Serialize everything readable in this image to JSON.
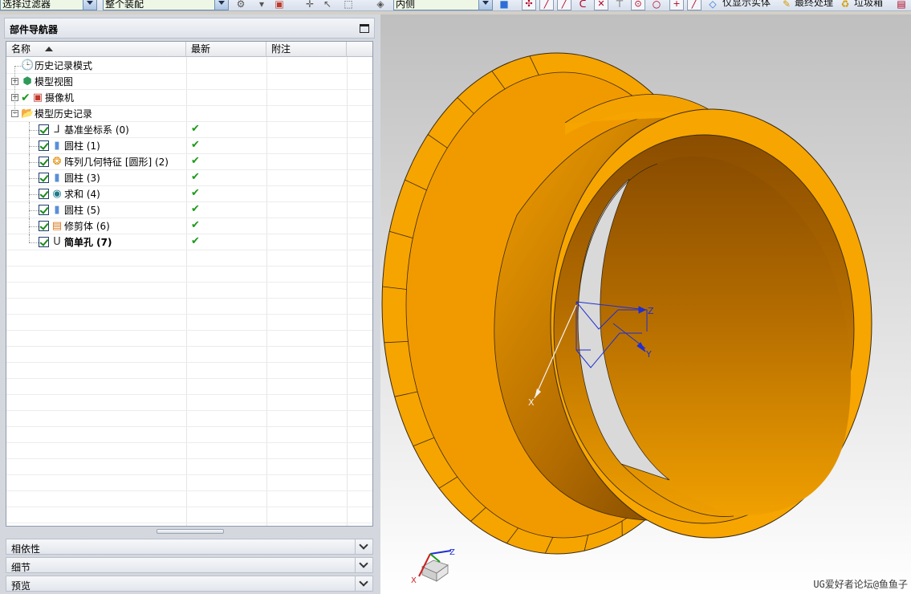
{
  "toolbar": {
    "filter_value": "选择过滤器",
    "scope_value": "整个装配",
    "side_value": "内侧",
    "show_solid_label": "仅显示实体",
    "final_process_label": "最终处理",
    "trash_label": "垃圾箱"
  },
  "navigator": {
    "title": "部件导航器",
    "columns": [
      "名称",
      "最新",
      "附注"
    ],
    "items": [
      {
        "label": "历史记录模式",
        "level": 0,
        "expander": "",
        "checkbox": false,
        "icon": "clock-icon",
        "latest": false,
        "bold": false
      },
      {
        "label": "模型视图",
        "level": 0,
        "expander": "+",
        "checkbox": false,
        "icon": "cube-view-icon",
        "latest": false,
        "bold": false
      },
      {
        "label": "摄像机",
        "level": 0,
        "expander": "+",
        "checkbox": false,
        "icon": "camera-icon",
        "latest": false,
        "bold": false
      },
      {
        "label": "模型历史记录",
        "level": 0,
        "expander": "-",
        "checkbox": false,
        "icon": "folder-icon",
        "latest": false,
        "bold": false
      },
      {
        "label": "基准坐标系 (0)",
        "level": 1,
        "expander": "",
        "checkbox": true,
        "icon": "datum-csys-icon",
        "latest": true,
        "bold": false
      },
      {
        "label": "圆柱 (1)",
        "level": 1,
        "expander": "",
        "checkbox": true,
        "icon": "cylinder-icon",
        "latest": true,
        "bold": false
      },
      {
        "label": "阵列几何特征 [圆形] (2)",
        "level": 1,
        "expander": "",
        "checkbox": true,
        "icon": "pattern-icon",
        "latest": true,
        "bold": false
      },
      {
        "label": "圆柱 (3)",
        "level": 1,
        "expander": "",
        "checkbox": true,
        "icon": "cylinder-icon",
        "latest": true,
        "bold": false
      },
      {
        "label": "求和 (4)",
        "level": 1,
        "expander": "",
        "checkbox": true,
        "icon": "unite-icon",
        "latest": true,
        "bold": false
      },
      {
        "label": "圆柱 (5)",
        "level": 1,
        "expander": "",
        "checkbox": true,
        "icon": "cylinder-icon",
        "latest": true,
        "bold": false
      },
      {
        "label": "修剪体 (6)",
        "level": 1,
        "expander": "",
        "checkbox": true,
        "icon": "trim-body-icon",
        "latest": true,
        "bold": false
      },
      {
        "label": "简单孔 (7)",
        "level": 1,
        "expander": "",
        "checkbox": true,
        "icon": "hole-icon",
        "latest": true,
        "bold": true
      }
    ],
    "panels": [
      "相依性",
      "细节",
      "预览"
    ]
  },
  "viewport": {
    "triad_labels": {
      "x": "X",
      "y": "Y",
      "z": "Z"
    },
    "watermark": "UG爱好者论坛@鱼鱼子"
  },
  "colors": {
    "part_orange": "#f7a600",
    "part_shade": "#a45f00",
    "csys_blue": "#1f2fd0",
    "check_green": "#1a9a1a"
  }
}
